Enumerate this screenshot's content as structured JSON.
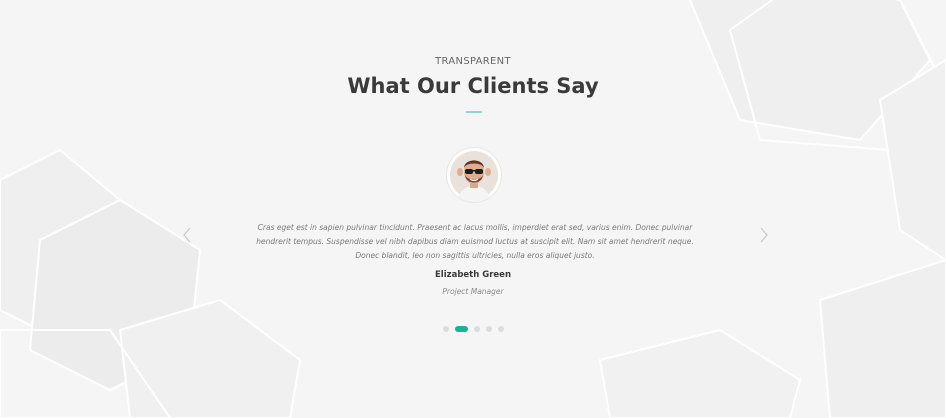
{
  "section": {
    "eyebrow": "TRANSPARENT",
    "title": "What Our Clients Say",
    "accent_color": "#1ab394"
  },
  "testimonial": {
    "quote": "Cras eget est in sapien pulvinar tincidunt. Praesent ac lacus mollis, imperdiet erat sed, varius enim. Donec pulvinar hendrerit tempus. Suspendisse vel nibh dapibus diam euismod luctus at suscipit elit. Nam sit amet hendrerit neque. Donec blandit, leo non sagittis ultricies, nulla eros aliquet justo.",
    "name": "Elizabeth Green",
    "role": "Project Manager",
    "avatar_icon": "person-with-sunglasses-avatar"
  },
  "carousel": {
    "prev_icon": "chevron-left-icon",
    "next_icon": "chevron-right-icon",
    "dots": [
      {
        "active": false
      },
      {
        "active": true
      },
      {
        "active": false
      },
      {
        "active": false
      },
      {
        "active": false
      }
    ]
  }
}
